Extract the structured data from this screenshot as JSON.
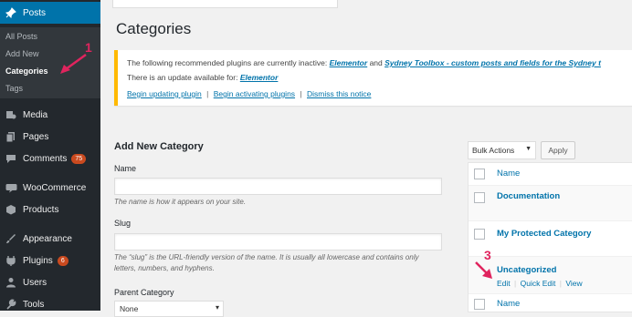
{
  "sidebar": {
    "posts_label": "Posts",
    "submenu": [
      {
        "label": "All Posts"
      },
      {
        "label": "Add New"
      },
      {
        "label": "Categories"
      },
      {
        "label": "Tags"
      }
    ],
    "items": [
      {
        "label": "Media",
        "icon": "media-icon"
      },
      {
        "label": "Pages",
        "icon": "pages-icon"
      },
      {
        "label": "Comments",
        "icon": "comments-icon",
        "badge": "75"
      },
      {
        "label": "WooCommerce",
        "icon": "woocommerce-icon"
      },
      {
        "label": "Products",
        "icon": "products-icon"
      },
      {
        "label": "Appearance",
        "icon": "appearance-icon"
      },
      {
        "label": "Plugins",
        "icon": "plugins-icon",
        "badge": "6"
      },
      {
        "label": "Users",
        "icon": "users-icon"
      },
      {
        "label": "Tools",
        "icon": "tools-icon"
      }
    ]
  },
  "page": {
    "title": "Categories"
  },
  "notice": {
    "line1_prefix": "The following recommended plugins are currently inactive:",
    "plugin1": "Elementor",
    "and": "and",
    "plugin2": "Sydney Toolbox - custom posts and fields for the Sydney t",
    "line2_prefix": "There is an update available for:",
    "update_plugin": "Elementor",
    "link_update": "Begin updating plugin",
    "link_activate": "Begin activating plugins",
    "link_dismiss": "Dismiss this notice",
    "separator": "|"
  },
  "add_category": {
    "heading": "Add New Category",
    "name_label": "Name",
    "name_value": "",
    "name_desc": "The name is how it appears on your site.",
    "slug_label": "Slug",
    "slug_value": "",
    "slug_desc_1": "The “slug” is the URL-friendly version of the name. It is usually all lowercase and contains only",
    "slug_desc_2": "letters, numbers, and hyphens.",
    "parent_label": "Parent Category",
    "parent_value": "None"
  },
  "list": {
    "bulk_actions": "Bulk Actions",
    "apply": "Apply",
    "header": "Name",
    "footer": "Name",
    "rows": [
      {
        "name": "Documentation"
      },
      {
        "name": "My Protected Category"
      },
      {
        "name": "Uncategorized"
      }
    ],
    "row_actions": {
      "edit": "Edit",
      "quick_edit": "Quick Edit",
      "view": "View",
      "separator": "|"
    }
  },
  "annotations": {
    "marker1": "1",
    "marker3": "3"
  },
  "colors": {
    "sidebar_bg": "#23282d",
    "accent": "#0073aa",
    "notice_border": "#ffb900",
    "marker": "#e0245e"
  }
}
